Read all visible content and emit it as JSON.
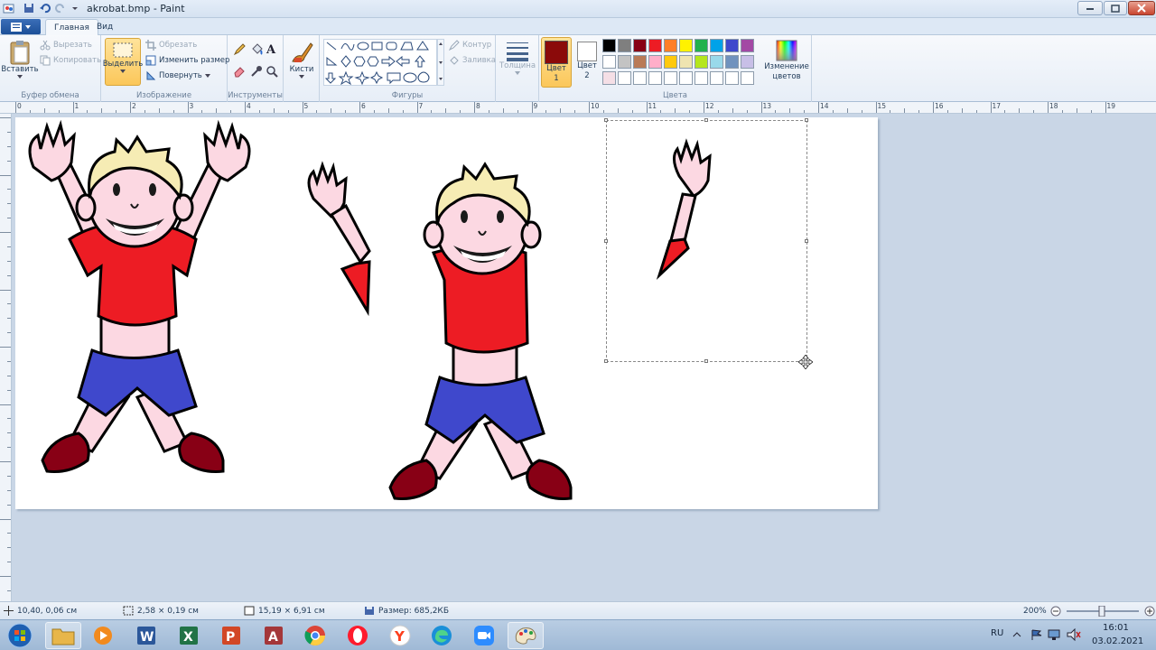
{
  "window": {
    "title": "akrobat.bmp - Paint"
  },
  "tabs": {
    "home": "Главная",
    "view": "Вид"
  },
  "ribbon": {
    "clipboard": {
      "group": "Буфер обмена",
      "paste": "Вставить",
      "cut": "Вырезать",
      "copy": "Копировать"
    },
    "image": {
      "group": "Изображение",
      "select": "Выделить",
      "crop": "Обрезать",
      "resize": "Изменить размер",
      "rotate": "Повернуть"
    },
    "tools": {
      "group": "Инструменты"
    },
    "brushes": {
      "label": "Кисти"
    },
    "shapes": {
      "group": "Фигуры",
      "outline": "Контур",
      "fill": "Заливка"
    },
    "size": {
      "label": "Толщина"
    },
    "colors": {
      "group": "Цвета",
      "color1_label": "Цвет 1",
      "color2_label": "Цвет 2",
      "color1": "#8b0a0a",
      "color2": "#ffffff",
      "edit_colors": "Изменение цветов",
      "palette_row1": [
        "#000000",
        "#7f7f7f",
        "#880015",
        "#ed1c24",
        "#ff7f27",
        "#fff200",
        "#22b14c",
        "#00a2e8",
        "#3f48cc",
        "#a349a4"
      ],
      "palette_row2": [
        "#ffffff",
        "#c3c3c3",
        "#b97a57",
        "#ffaec9",
        "#ffc90e",
        "#efe4b0",
        "#b5e61d",
        "#99d9ea",
        "#7092be",
        "#c8bfe7"
      ],
      "palette_row3": [
        "#f5dfe6",
        "#ffffff",
        "#ffffff",
        "#ffffff",
        "#ffffff",
        "#ffffff",
        "#ffffff",
        "#ffffff",
        "#ffffff",
        "#ffffff"
      ]
    }
  },
  "ruler": {
    "labels": [
      "0",
      "1",
      "2",
      "3",
      "4",
      "5",
      "6",
      "7",
      "8",
      "9",
      "10",
      "11",
      "12",
      "13",
      "14",
      "15",
      "16",
      "17",
      "18",
      "19"
    ]
  },
  "status": {
    "cursor_pos": "10,40, 0,06 см",
    "selection_size": "2,58 × 0,19 см",
    "image_size": "15,19 × 6,91 см",
    "file_size": "Размер: 685,2КБ",
    "zoom": "200%"
  },
  "taskbar": {
    "apps": [
      "start",
      "explorer",
      "media-player",
      "word",
      "excel",
      "powerpoint",
      "access",
      "chrome",
      "opera",
      "yandex",
      "edge",
      "zoom",
      "paint"
    ],
    "lang": "RU",
    "time": "16:01",
    "date": "03.02.2021"
  },
  "drawing": {
    "shirt": "#ed1c24",
    "shorts": "#3f48cc",
    "shoes": "#880015",
    "skin": "#fcd8e2",
    "hair": "#f6ecb4"
  }
}
